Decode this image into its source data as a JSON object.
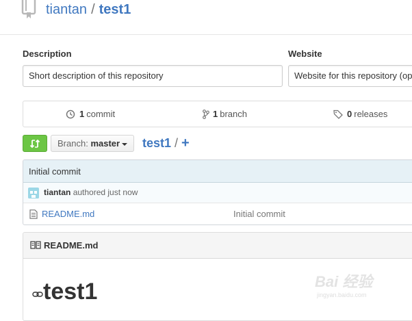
{
  "repo": {
    "owner": "tiantan",
    "separator": "/",
    "name": "test1"
  },
  "description": {
    "label": "Description",
    "placeholder": "Short description of this repository"
  },
  "website": {
    "label": "Website",
    "placeholder": "Website for this repository (op"
  },
  "stats": {
    "commits_count": "1",
    "commits_label": "commit",
    "branches_count": "1",
    "branches_label": "branch",
    "releases_count": "0",
    "releases_label": "releases"
  },
  "toolbar": {
    "branch_prefix": "Branch:",
    "branch_name": "master",
    "breadcrumb_root": "test1",
    "breadcrumb_sep": "/",
    "add_file": "+"
  },
  "commit": {
    "message": "Initial commit",
    "author": "tiantan",
    "authored_text": "authored just now"
  },
  "files": [
    {
      "name": "README.md",
      "message": "Initial commit",
      "icon": "file-text-icon"
    }
  ],
  "readme": {
    "header": "README.md",
    "heading": "test1"
  },
  "watermark": {
    "brand": "Bai 经验",
    "site": "jingyan.baidu.com"
  },
  "colors": {
    "link": "#4078c0",
    "compare_button": "#6cc644",
    "commit_bar": "#e6f1f6",
    "avatar": "#9cd7e6"
  }
}
